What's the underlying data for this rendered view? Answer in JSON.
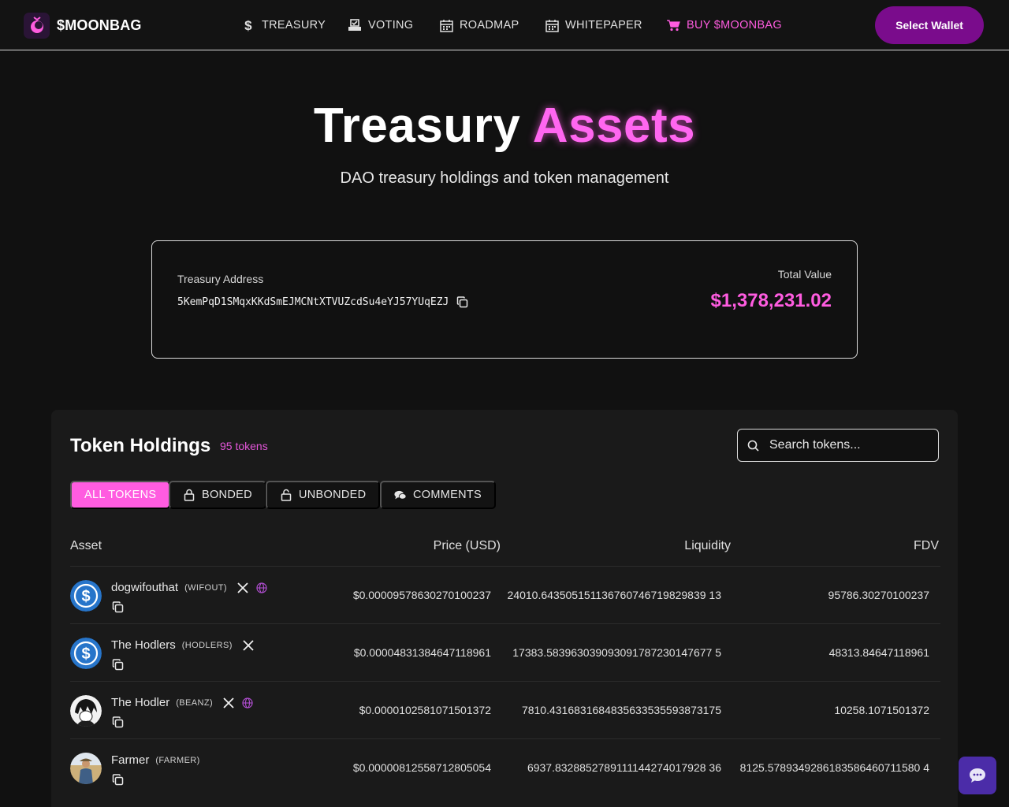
{
  "nav": {
    "brand": "$MOONBAG",
    "items": [
      {
        "label": "TREASURY",
        "icon": "dollar-icon"
      },
      {
        "label": "VOTING",
        "icon": "ballot-icon"
      },
      {
        "label": "ROADMAP",
        "icon": "calendar-icon"
      },
      {
        "label": "WHITEPAPER",
        "icon": "calendar-icon"
      },
      {
        "label": "BUY $MOONBAG",
        "icon": "cart-icon"
      }
    ],
    "wallet_label": "Select Wallet"
  },
  "hero": {
    "title_main": "Treasury",
    "title_accent": "Assets",
    "subtitle": "DAO treasury holdings and token management"
  },
  "treasury": {
    "address_label": "Treasury Address",
    "address": "5KemPqD1SMqxKKdSmEJMCNtXTVUZcdSu4eYJ57YUqEZJ",
    "total_label": "Total Value",
    "total_value": "$1,378,231.02"
  },
  "holdings": {
    "title": "Token Holdings",
    "count": "95 tokens",
    "search_placeholder": "Search tokens...",
    "tabs": [
      {
        "label": "ALL TOKENS",
        "icon": "",
        "active": true
      },
      {
        "label": "BONDED",
        "icon": "lock-icon",
        "active": false
      },
      {
        "label": "UNBONDED",
        "icon": "unlock-icon",
        "active": false
      },
      {
        "label": "COMMENTS",
        "icon": "comments-icon",
        "active": false
      }
    ],
    "columns": {
      "asset": "Asset",
      "price": "Price (USD)",
      "liquidity": "Liquidity",
      "fdv": "FDV"
    },
    "rows": [
      {
        "name": "dogwifouthat",
        "symbol": "(WIFOUT)",
        "price": "$0.00009578630270100237",
        "liquidity": "24010.643505151136760746719829839 13",
        "fdv": "95786.30270100237",
        "x": true,
        "web": true
      },
      {
        "name": "The Hodlers",
        "symbol": "(HODLERS)",
        "price": "$0.00004831384647118961",
        "liquidity": "17383.583963039093091787230147677 5",
        "fdv": "48313.84647118961",
        "x": true,
        "web": false
      },
      {
        "name": "The Hodler",
        "symbol": "(BEANZ)",
        "price": "$0.0000102581071501372",
        "liquidity": "7810.4316831684835633535593873175",
        "fdv": "10258.1071501372",
        "x": true,
        "web": true
      },
      {
        "name": "Farmer",
        "symbol": "(FARMER)",
        "price": "$0.00000812558712805054",
        "liquidity": "6937.8328852789111144274017928 36",
        "fdv": "8125.5789349286183586460711580 4",
        "x": false,
        "web": false
      }
    ]
  },
  "colors": {
    "accent": "#ff5ce0",
    "wallet": "#7a0c8c",
    "chat": "#4b2ca8"
  }
}
